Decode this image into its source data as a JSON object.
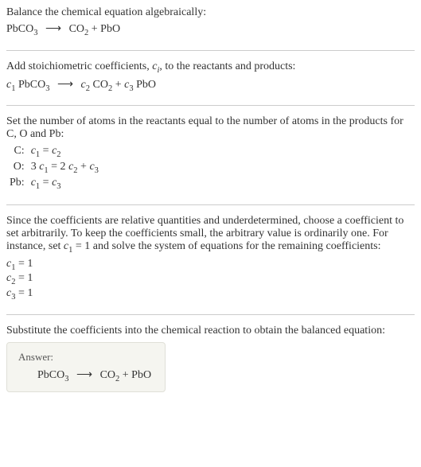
{
  "section1": {
    "title": "Balance the chemical equation algebraically:",
    "equation_lhs": "PbCO",
    "equation_lhs_sub": "3",
    "equation_rhs1": "CO",
    "equation_rhs1_sub": "2",
    "equation_rhs2": "PbO"
  },
  "section2": {
    "title_part1": "Add stoichiometric coefficients, ",
    "title_ci": "c",
    "title_ci_sub": "i",
    "title_part2": ", to the reactants and products:",
    "c1": "c",
    "c1_sub": "1",
    "r1": "PbCO",
    "r1_sub": "3",
    "c2": "c",
    "c2_sub": "2",
    "p1": "CO",
    "p1_sub": "2",
    "c3": "c",
    "c3_sub": "3",
    "p2": "PbO"
  },
  "section3": {
    "title": "Set the number of atoms in the reactants equal to the number of atoms in the products for C, O and Pb:",
    "rows": [
      {
        "label": "C:",
        "c1": "c",
        "c1_sub": "1",
        "eq": " = ",
        "c2": "c",
        "c2_sub": "2",
        "rest": ""
      },
      {
        "label": "O:",
        "pre": "3 ",
        "c1": "c",
        "c1_sub": "1",
        "eq": " = 2 ",
        "c2": "c",
        "c2_sub": "2",
        "plus": " + ",
        "c3": "c",
        "c3_sub": "3"
      },
      {
        "label": "Pb:",
        "c1": "c",
        "c1_sub": "1",
        "eq": " = ",
        "c2": "c",
        "c2_sub": "3",
        "rest": ""
      }
    ]
  },
  "section4": {
    "title_part1": "Since the coefficients are relative quantities and underdetermined, choose a coefficient to set arbitrarily. To keep the coefficients small, the arbitrary value is ordinarily one. For instance, set ",
    "set_c": "c",
    "set_c_sub": "1",
    "set_val": " = 1",
    "title_part2": " and solve the system of equations for the remaining coefficients:",
    "coefs": [
      {
        "c": "c",
        "sub": "1",
        "val": " = 1"
      },
      {
        "c": "c",
        "sub": "2",
        "val": " = 1"
      },
      {
        "c": "c",
        "sub": "3",
        "val": " = 1"
      }
    ]
  },
  "section5": {
    "title": "Substitute the coefficients into the chemical reaction to obtain the balanced equation:",
    "answer_label": "Answer:",
    "lhs": "PbCO",
    "lhs_sub": "3",
    "rhs1": "CO",
    "rhs1_sub": "2",
    "rhs2": "PbO"
  },
  "arrow": "⟶",
  "plus": " + "
}
